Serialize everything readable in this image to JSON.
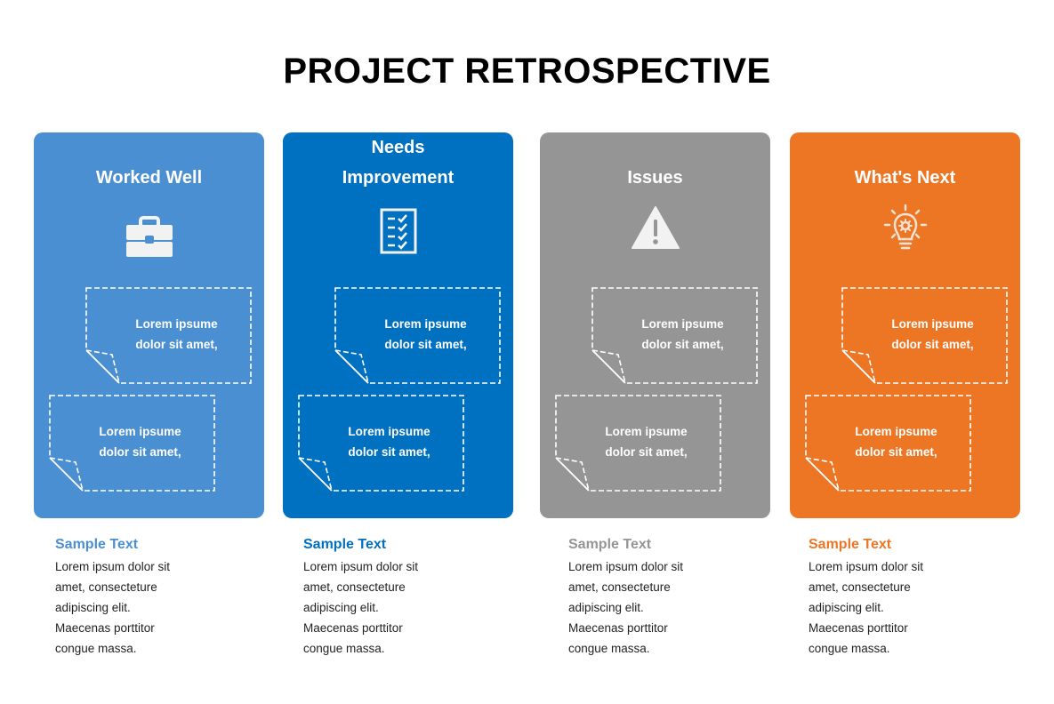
{
  "title": "PROJECT RETROSPECTIVE",
  "columns": [
    {
      "heading_lines": [
        "Worked Well"
      ],
      "icon": "briefcase-icon",
      "color": "#4a8fd1",
      "notes": [
        {
          "line1": "Lorem ipsume",
          "line2": "dolor sit amet,"
        },
        {
          "line1": "Lorem ipsume",
          "line2": "dolor sit amet,"
        }
      ],
      "caption_title": "Sample Text",
      "caption_lines": [
        "Lorem ipsum dolor sit",
        "amet, consecteture",
        "adipiscing elit.",
        "Maecenas porttitor",
        "congue massa."
      ]
    },
    {
      "heading_lines": [
        "Needs",
        "Improvement"
      ],
      "icon": "checklist-icon",
      "color": "#0070c0",
      "notes": [
        {
          "line1": "Lorem ipsume",
          "line2": "dolor sit amet,"
        },
        {
          "line1": "Lorem ipsume",
          "line2": "dolor sit amet,"
        }
      ],
      "caption_title": "Sample Text",
      "caption_lines": [
        "Lorem ipsum dolor sit",
        "amet, consecteture",
        "adipiscing elit.",
        "Maecenas porttitor",
        "congue massa."
      ]
    },
    {
      "heading_lines": [
        "Issues"
      ],
      "icon": "warning-icon",
      "color": "#959595",
      "notes": [
        {
          "line1": "Lorem ipsume",
          "line2": "dolor sit amet,"
        },
        {
          "line1": "Lorem ipsume",
          "line2": "dolor sit amet,"
        }
      ],
      "caption_title": "Sample Text",
      "caption_lines": [
        "Lorem ipsum dolor sit",
        "amet, consecteture",
        "adipiscing elit.",
        "Maecenas porttitor",
        "congue massa."
      ]
    },
    {
      "heading_lines": [
        "What's Next"
      ],
      "icon": "lightbulb-icon",
      "color": "#ed7625",
      "notes": [
        {
          "line1": "Lorem ipsume",
          "line2": "dolor sit amet,"
        },
        {
          "line1": "Lorem ipsume",
          "line2": "dolor sit amet,"
        }
      ],
      "caption_title": "Sample Text",
      "caption_lines": [
        "Lorem ipsum dolor sit",
        "amet, consecteture",
        "adipiscing elit.",
        "Maecenas porttitor",
        "congue massa."
      ]
    }
  ]
}
